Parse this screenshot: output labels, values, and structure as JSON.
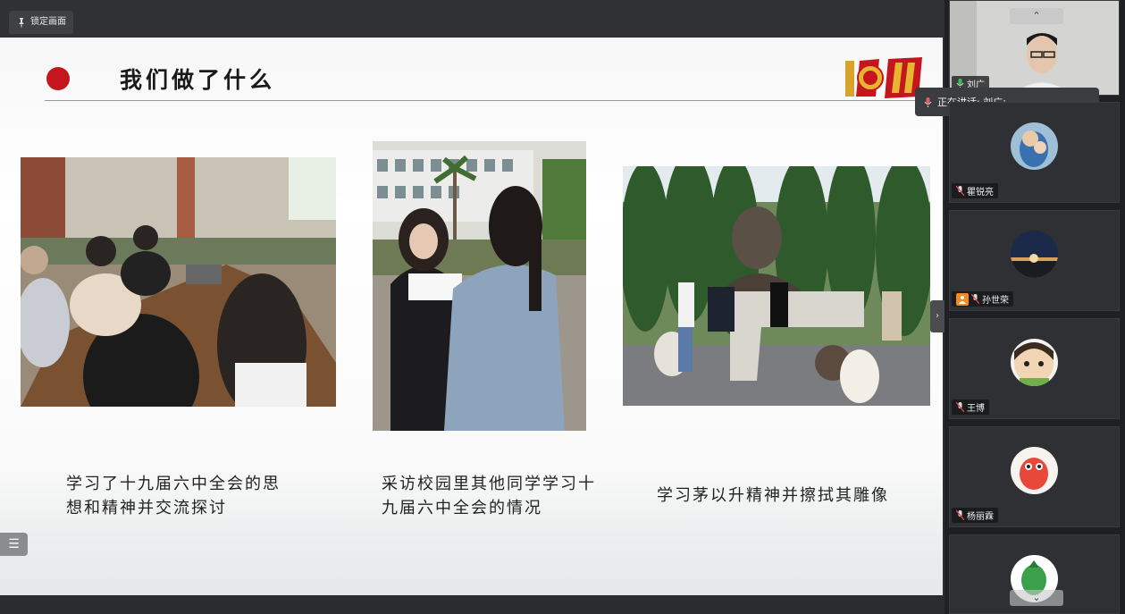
{
  "toolbar": {
    "lock_label": "锁定画面"
  },
  "slide": {
    "title": "我们做了什么",
    "items": [
      {
        "caption_line1": "学习了十九届六中全会的思",
        "caption_line2": "想和精神并交流探讨"
      },
      {
        "caption_line1": "采访校园里其他同学学习十",
        "caption_line2": "九届六中全会的情况"
      },
      {
        "caption_line1": "学习茅以升精神并擦拭其雕像",
        "caption_line2": ""
      }
    ]
  },
  "participants": [
    {
      "name": "刘广",
      "mic": "on"
    },
    {
      "name": "瞿锐亮",
      "mic": "muted"
    },
    {
      "name": "孙世荣",
      "mic": "muted",
      "host": true
    },
    {
      "name": "王博",
      "mic": "muted"
    },
    {
      "name": "杨丽霖",
      "mic": "muted"
    }
  ],
  "speaking_banner": {
    "text": "正在讲话: 刘广;"
  },
  "colors": {
    "accent_red": "#c4161c",
    "panel_bg": "#1f2023",
    "host_orange": "#f08a24"
  },
  "icons": [
    "pin-icon",
    "list-icon",
    "microphone-icon",
    "chevron-up-icon",
    "chevron-down-icon",
    "chevron-right-icon"
  ]
}
